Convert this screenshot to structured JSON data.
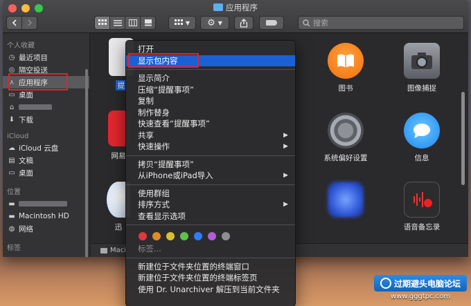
{
  "window": {
    "title": "应用程序"
  },
  "search": {
    "placeholder": "搜索"
  },
  "sidebar": {
    "sections": [
      {
        "heading": "个人收藏",
        "items": [
          {
            "label": "最近项目",
            "icon": "clock-icon"
          },
          {
            "label": "隔空投送",
            "icon": "airdrop-icon"
          },
          {
            "label": "应用程序",
            "icon": "applications-icon",
            "active": true
          },
          {
            "label": "桌面",
            "icon": "desktop-icon"
          },
          {
            "label": "",
            "icon": "home-icon",
            "blurred": true
          },
          {
            "label": "下载",
            "icon": "download-icon"
          }
        ]
      },
      {
        "heading": "iCloud",
        "items": [
          {
            "label": "iCloud 云盘",
            "icon": "cloud-icon"
          },
          {
            "label": "文稿",
            "icon": "document-icon"
          },
          {
            "label": "桌面",
            "icon": "desktop-icon"
          }
        ]
      },
      {
        "heading": "位置",
        "items": [
          {
            "label": "",
            "icon": "drive-icon",
            "blurred": true
          },
          {
            "label": "Macintosh HD",
            "icon": "drive-icon"
          },
          {
            "label": "网络",
            "icon": "network-icon"
          }
        ]
      },
      {
        "heading": "标签",
        "items": []
      }
    ]
  },
  "apps": {
    "books": "图书",
    "image_capture": "图像捕捉",
    "system_prefs": "系统偏好设置",
    "messages": "信息",
    "voice_memos": "语音备忘录",
    "partial_1": "提",
    "partial_2": "网易",
    "partial_3": "迅"
  },
  "path_bar": {
    "text": "Maci"
  },
  "context_menu": {
    "items_group1": [
      "打开",
      "显示包内容"
    ],
    "items_group2": [
      "显示简介",
      "压缩“提醒事项”",
      "复制",
      "制作替身",
      "快速查看“提醒事项”",
      "共享",
      "快速操作"
    ],
    "items_group3": [
      "拷贝“提醒事项”",
      "从iPhone或iPad导入"
    ],
    "items_group4": [
      "使用群组",
      "排序方式",
      "查看显示选项"
    ],
    "tag_label": "标签...",
    "tag_colors": [
      "#e0383e",
      "#e08a2a",
      "#d8c02c",
      "#5ec24a",
      "#2f7cf6",
      "#b15fd6",
      "#8e8e93"
    ],
    "items_group5": [
      "新建位于文件夹位置的终端窗口",
      "新建位于文件夹位置的终端标签页",
      "使用 Dr. Unarchiver 解压到当前文件夹"
    ]
  },
  "watermark": {
    "title": "过期避头电脑论坛",
    "url": "www.gggtpc.com"
  }
}
